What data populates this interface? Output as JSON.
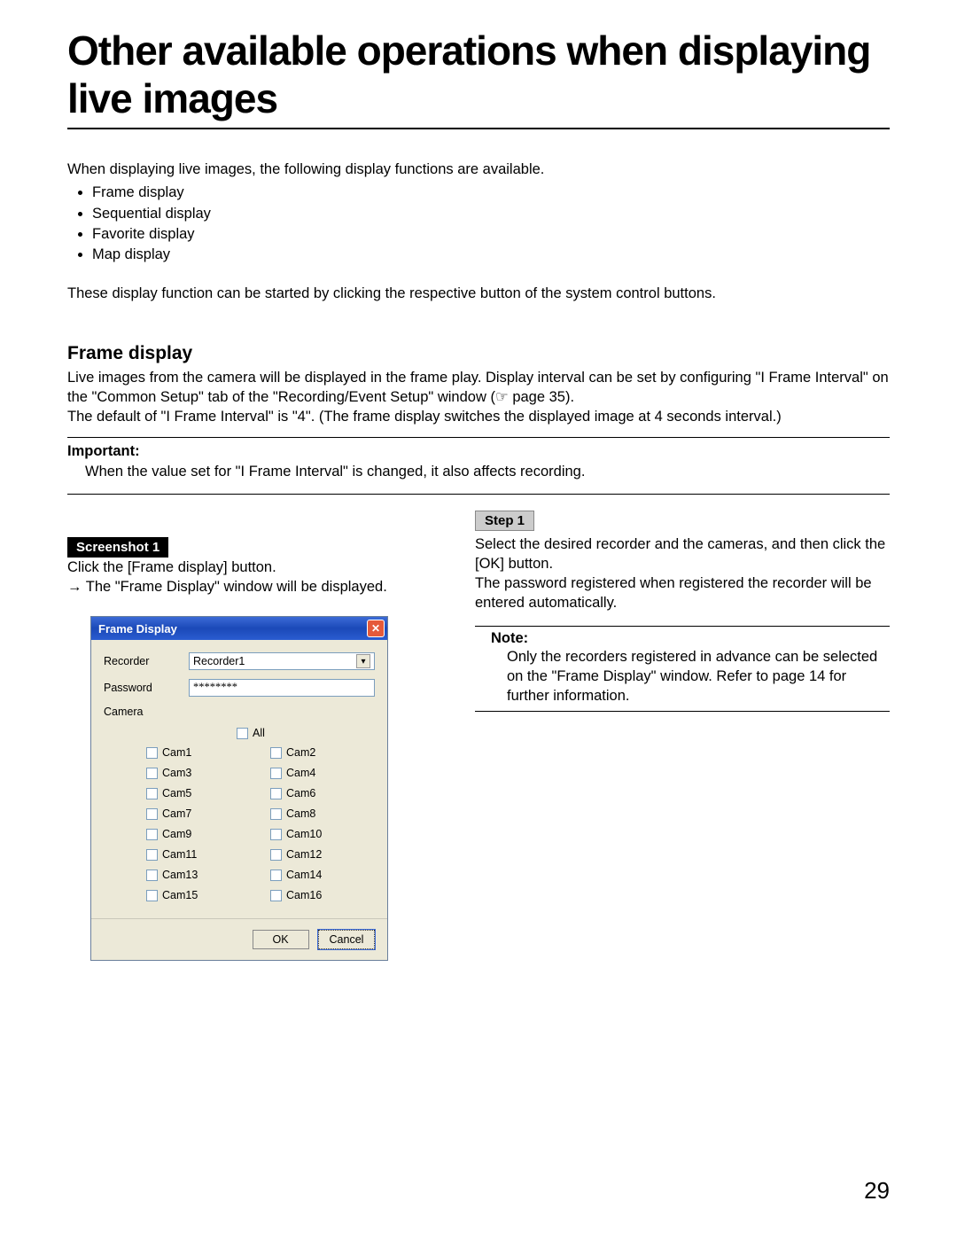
{
  "title": "Other available operations when displaying live images",
  "intro_lead": "When displaying live images, the following display functions are available.",
  "intro_items": [
    "Frame display",
    "Sequential display",
    "Favorite display",
    "Map display"
  ],
  "intro_footer": "These display function can be started by clicking the respective button of the system control buttons.",
  "section": {
    "heading": "Frame display",
    "p1": "Live images from the camera will be displayed in the frame play. Display interval can be set by configuring \"I Frame Interval\" on the \"Common Setup\" tab of the \"Recording/Event Setup\" window (☞ page 35).",
    "p2": "The default of \"I Frame Interval\" is \"4\". (The frame display switches the displayed image at 4 seconds interval.)"
  },
  "important": {
    "label": "Important:",
    "text": "When the value set for \"I Frame Interval\" is changed, it also affects recording."
  },
  "screenshot_badge": "Screenshot 1",
  "screenshot_caption1": "Click the [Frame display] button.",
  "screenshot_caption2": "→ The \"Frame Display\" window will be displayed.",
  "dialog": {
    "title": "Frame Display",
    "recorder_label": "Recorder",
    "recorder_value": "Recorder1",
    "password_label": "Password",
    "password_value": "********",
    "camera_label": "Camera",
    "all_label": "All",
    "cams_left": [
      "Cam1",
      "Cam3",
      "Cam5",
      "Cam7",
      "Cam9",
      "Cam11",
      "Cam13",
      "Cam15"
    ],
    "cams_right": [
      "Cam2",
      "Cam4",
      "Cam6",
      "Cam8",
      "Cam10",
      "Cam12",
      "Cam14",
      "Cam16"
    ],
    "ok": "OK",
    "cancel": "Cancel"
  },
  "step": {
    "badge": "Step 1",
    "text": "Select the desired recorder and the cameras, and then click the [OK] button.\nThe password registered when registered the recorder will be entered automatically."
  },
  "note": {
    "label": "Note:",
    "text": "Only the recorders registered in advance can be selected on the \"Frame Display\" window. Refer to page 14 for further information."
  },
  "page_number": "29"
}
